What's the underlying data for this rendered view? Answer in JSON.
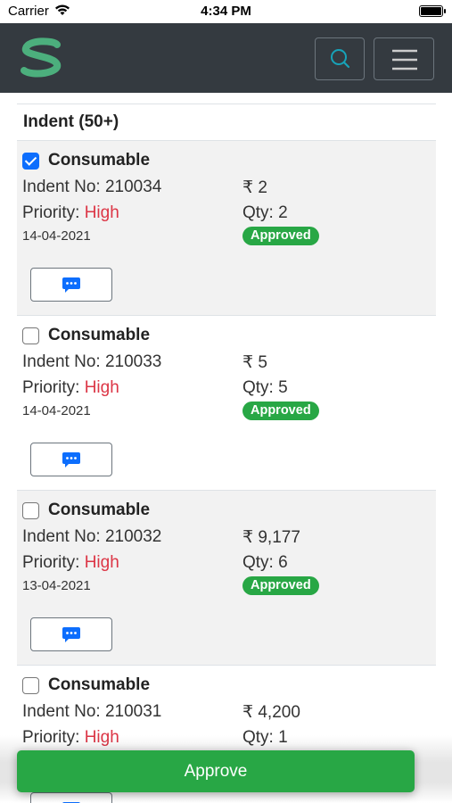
{
  "status_bar": {
    "carrier": "Carrier",
    "time": "4:34 PM"
  },
  "navbar": {
    "logo_letter": "S",
    "brand_color": "#4caf7d"
  },
  "list": {
    "title": "Indent",
    "count": "(50+)"
  },
  "items": [
    {
      "checked": true,
      "category": "Consumable",
      "indent_label": "Indent No: 210034",
      "amount": "₹ 2",
      "priority_label": "Priority:",
      "priority_value": "High",
      "qty": "Qty: 2",
      "date": "14-04-2021",
      "status": "Approved"
    },
    {
      "checked": false,
      "category": "Consumable",
      "indent_label": "Indent No: 210033",
      "amount": "₹ 5",
      "priority_label": "Priority:",
      "priority_value": "High",
      "qty": "Qty: 5",
      "date": "14-04-2021",
      "status": "Approved"
    },
    {
      "checked": false,
      "category": "Consumable",
      "indent_label": "Indent No: 210032",
      "amount": "₹ 9,177",
      "priority_label": "Priority:",
      "priority_value": "High",
      "qty": "Qty: 6",
      "date": "13-04-2021",
      "status": "Approved"
    },
    {
      "checked": false,
      "category": "Consumable",
      "indent_label": "Indent No: 210031",
      "amount": "₹ 4,200",
      "priority_label": "Priority:",
      "priority_value": "High",
      "qty": "Qty: 1",
      "date": "",
      "status": ""
    }
  ],
  "footer": {
    "approve_label": "Approve"
  },
  "colors": {
    "navbar": "#343a40",
    "approved": "#28a745",
    "priority_high": "#dc3545",
    "checkbox": "#0d6efd",
    "comment_icon": "#0d6efd"
  },
  "icons": {
    "search": "search-icon",
    "menu": "hamburger-menu-icon",
    "comment": "chat-bubble-icon",
    "wifi": "wifi-icon",
    "battery": "battery-icon"
  }
}
